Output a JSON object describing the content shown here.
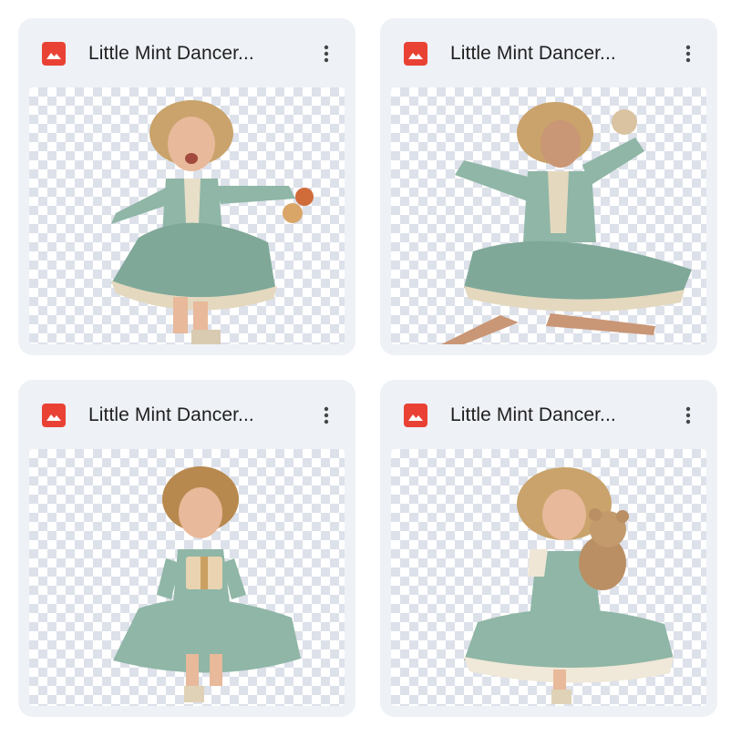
{
  "files": [
    {
      "name": "Little Mint Dancer...",
      "icon": "image-file-icon",
      "menu_icon": "more-vert-icon"
    },
    {
      "name": "Little Mint Dancer...",
      "icon": "image-file-icon",
      "menu_icon": "more-vert-icon"
    },
    {
      "name": "Little Mint Dancer...",
      "icon": "image-file-icon",
      "menu_icon": "more-vert-icon"
    },
    {
      "name": "Little Mint Dancer...",
      "icon": "image-file-icon",
      "menu_icon": "more-vert-icon"
    }
  ],
  "colors": {
    "card_bg": "#eef1f6",
    "file_icon": "#e94235",
    "dress_mint": "#8fb6a6",
    "hair_blonde": "#c9a36b",
    "skin": "#e8b99a",
    "text": "#1f1f1f"
  }
}
